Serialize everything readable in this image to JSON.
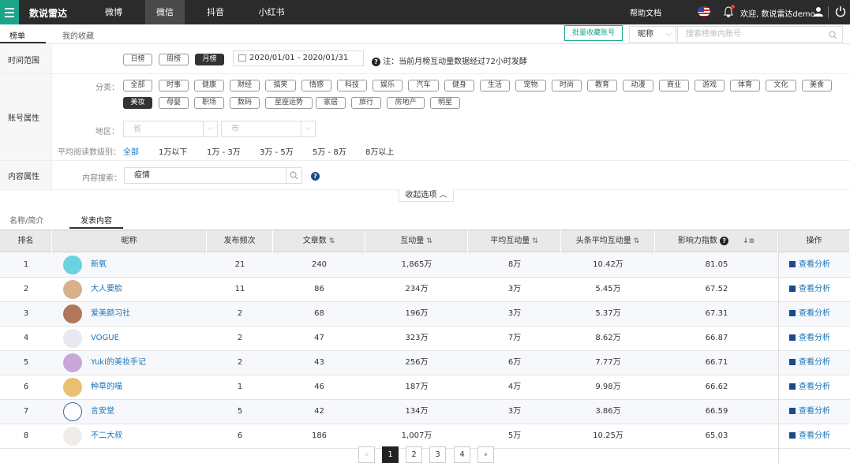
{
  "app": {
    "brand": "数说雷达"
  },
  "nav": {
    "tabs": [
      "微博",
      "微信",
      "抖音",
      "小红书"
    ],
    "active": "微信"
  },
  "header": {
    "help": "帮助文档",
    "welcome": "欢迎, 数说雷达demo"
  },
  "subbar": {
    "tabs": [
      "榜单",
      "我的收藏"
    ],
    "batch_button": "批量收藏账号",
    "select_value": "昵称",
    "search_placeholder": "搜索榜单内账号"
  },
  "filters": {
    "time_label": "时间范围",
    "period_pills": [
      "日榜",
      "周榜",
      "月榜"
    ],
    "period_active": "月榜",
    "date_range": "2020/01/01 - 2020/01/31",
    "note": "注：当前月榜互动量数据经过72小时发酵",
    "account_label": "账号属性",
    "category_label": "分类：",
    "categories_row1": [
      "全部",
      "时事",
      "健康",
      "财经",
      "搞笑",
      "情感",
      "科技",
      "娱乐",
      "汽车",
      "健身",
      "生活",
      "宠物",
      "时尚",
      "教育",
      "动漫",
      "商业",
      "游戏",
      "体育",
      "文化",
      "美食"
    ],
    "categories_row2": [
      "美妆",
      "母婴",
      "职场",
      "数码",
      "星座运势",
      "家居",
      "旅行",
      "房地产",
      "明星"
    ],
    "category_active": "美妆",
    "region_label": "地区：",
    "province_placeholder": "省",
    "city_placeholder": "市",
    "reading_label": "平均阅读数级别：",
    "reading_levels": [
      "全部",
      "1万以下",
      "1万 - 3万",
      "3万 - 5万",
      "5万 - 8万",
      "8万以上"
    ],
    "reading_active": "全部",
    "content_label": "内容属性",
    "content_search_label": "内容搜索：",
    "content_search_value": "疫情",
    "collapse": "收起选项"
  },
  "content_tabs": [
    "名称/简介",
    "发表内容"
  ],
  "table": {
    "headers": [
      "排名",
      "昵称",
      "发布频次",
      "文章数",
      "互动量",
      "平均互动量",
      "头条平均互动量",
      "影响力指数",
      "操作"
    ],
    "action_label": "查看分析",
    "rows": [
      {
        "rank": "1",
        "name": "新氧",
        "freq": "21",
        "articles": "240",
        "interactions": "1,865万",
        "avg": "8万",
        "head_avg": "10.42万",
        "index": "81.05"
      },
      {
        "rank": "2",
        "name": "大人要脸",
        "freq": "11",
        "articles": "86",
        "interactions": "234万",
        "avg": "3万",
        "head_avg": "5.45万",
        "index": "67.52"
      },
      {
        "rank": "3",
        "name": "爱美颜习社",
        "freq": "2",
        "articles": "68",
        "interactions": "196万",
        "avg": "3万",
        "head_avg": "5.37万",
        "index": "67.31"
      },
      {
        "rank": "4",
        "name": "VOGUE",
        "freq": "2",
        "articles": "47",
        "interactions": "323万",
        "avg": "7万",
        "head_avg": "8.62万",
        "index": "66.87"
      },
      {
        "rank": "5",
        "name": "Yuki的美妆手记",
        "freq": "2",
        "articles": "43",
        "interactions": "256万",
        "avg": "6万",
        "head_avg": "7.77万",
        "index": "66.71"
      },
      {
        "rank": "6",
        "name": "种草的喵",
        "freq": "1",
        "articles": "46",
        "interactions": "187万",
        "avg": "4万",
        "head_avg": "9.98万",
        "index": "66.62"
      },
      {
        "rank": "7",
        "name": "言安堂",
        "freq": "5",
        "articles": "42",
        "interactions": "134万",
        "avg": "3万",
        "head_avg": "3.86万",
        "index": "66.59"
      },
      {
        "rank": "8",
        "name": "不二大叔",
        "freq": "6",
        "articles": "186",
        "interactions": "1,007万",
        "avg": "5万",
        "head_avg": "10.25万",
        "index": "65.03"
      }
    ]
  },
  "pagination": {
    "pages": [
      "1",
      "2",
      "3",
      "4"
    ],
    "active": "1"
  }
}
